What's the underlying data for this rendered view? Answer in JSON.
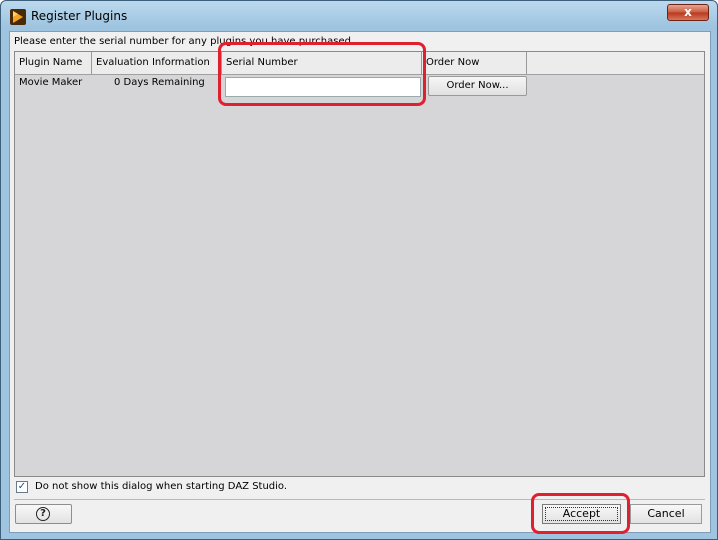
{
  "window": {
    "title": "Register Plugins",
    "close_label": "x"
  },
  "instructions": "Please enter the serial number for any plugins you have purchased.",
  "table": {
    "columns": [
      "Plugin Name",
      "Evaluation Information",
      "Serial Number",
      "Order Now"
    ],
    "rows": [
      {
        "plugin_name": "Movie Maker",
        "evaluation": "0 Days Remaining",
        "serial": "",
        "order_label": "Order Now..."
      }
    ]
  },
  "checkbox": {
    "checked": true,
    "mark": "✓",
    "label": "Do not show this dialog when starting DAZ Studio."
  },
  "buttons": {
    "help": "?",
    "accept": "Accept",
    "cancel": "Cancel"
  },
  "highlights": {
    "color": "#e0202f"
  }
}
